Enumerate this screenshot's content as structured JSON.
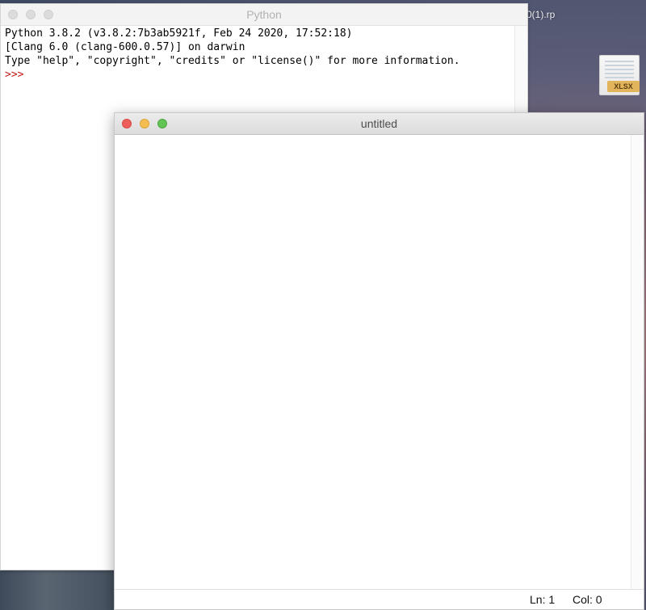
{
  "desktop": {
    "file_label": "0(1).rp",
    "file_badge": "XLSX"
  },
  "shell_window": {
    "title": "Python",
    "lines": [
      "Python 3.8.2 (v3.8.2:7b3ab5921f, Feb 24 2020, 17:52:18)",
      "[Clang 6.0 (clang-600.0.57)] on darwin",
      "Type \"help\", \"copyright\", \"credits\" or \"license()\" for more information."
    ],
    "prompt": ">>>"
  },
  "editor_window": {
    "title": "untitled",
    "content": "",
    "status": {
      "ln": "Ln: 1",
      "col": "Col: 0"
    }
  },
  "colors": {
    "close": "#ee5f5b",
    "minimize": "#f5bd4f",
    "zoom": "#61c454",
    "prompt": "#c41a16"
  }
}
